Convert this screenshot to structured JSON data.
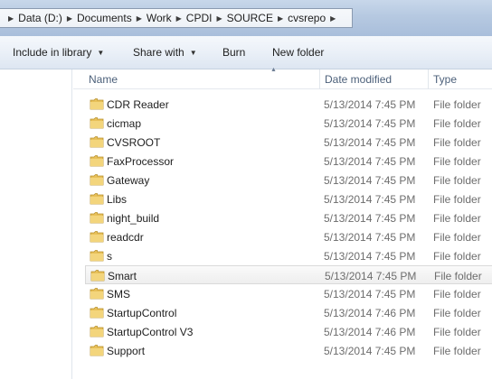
{
  "breadcrumb": [
    "Data (D:)",
    "Documents",
    "Work",
    "CPDI",
    "SOURCE",
    "cvsrepo"
  ],
  "toolbar": {
    "include_in_library": "Include in library",
    "share_with": "Share with",
    "burn": "Burn",
    "new_folder": "New folder"
  },
  "columns": {
    "name": "Name",
    "date_modified": "Date modified",
    "type": "Type"
  },
  "files": [
    {
      "name": "CDR Reader",
      "date": "5/13/2014 7:45 PM",
      "type": "File folder"
    },
    {
      "name": "cicmap",
      "date": "5/13/2014 7:45 PM",
      "type": "File folder"
    },
    {
      "name": "CVSROOT",
      "date": "5/13/2014 7:45 PM",
      "type": "File folder"
    },
    {
      "name": "FaxProcessor",
      "date": "5/13/2014 7:45 PM",
      "type": "File folder"
    },
    {
      "name": "Gateway",
      "date": "5/13/2014 7:45 PM",
      "type": "File folder"
    },
    {
      "name": "Libs",
      "date": "5/13/2014 7:45 PM",
      "type": "File folder"
    },
    {
      "name": "night_build",
      "date": "5/13/2014 7:45 PM",
      "type": "File folder"
    },
    {
      "name": "readcdr",
      "date": "5/13/2014 7:45 PM",
      "type": "File folder"
    },
    {
      "name": "s",
      "date": "5/13/2014 7:45 PM",
      "type": "File folder"
    },
    {
      "name": "Smart",
      "date": "5/13/2014 7:45 PM",
      "type": "File folder",
      "selected": true
    },
    {
      "name": "SMS",
      "date": "5/13/2014 7:45 PM",
      "type": "File folder"
    },
    {
      "name": "StartupControl",
      "date": "5/13/2014 7:46 PM",
      "type": "File folder"
    },
    {
      "name": "StartupControl V3",
      "date": "5/13/2014 7:46 PM",
      "type": "File folder"
    },
    {
      "name": "Support",
      "date": "5/13/2014 7:45 PM",
      "type": "File folder"
    }
  ],
  "colors": {
    "folder": "#e8c15a",
    "header_text": "#4c607a",
    "secondary_text": "#6d6d6d"
  },
  "icons": {
    "folder": "folder-icon",
    "breadcrumb_separator": "chevron-right-icon",
    "dropdown": "chevron-down-icon",
    "sort": "sort-ascending-icon"
  }
}
